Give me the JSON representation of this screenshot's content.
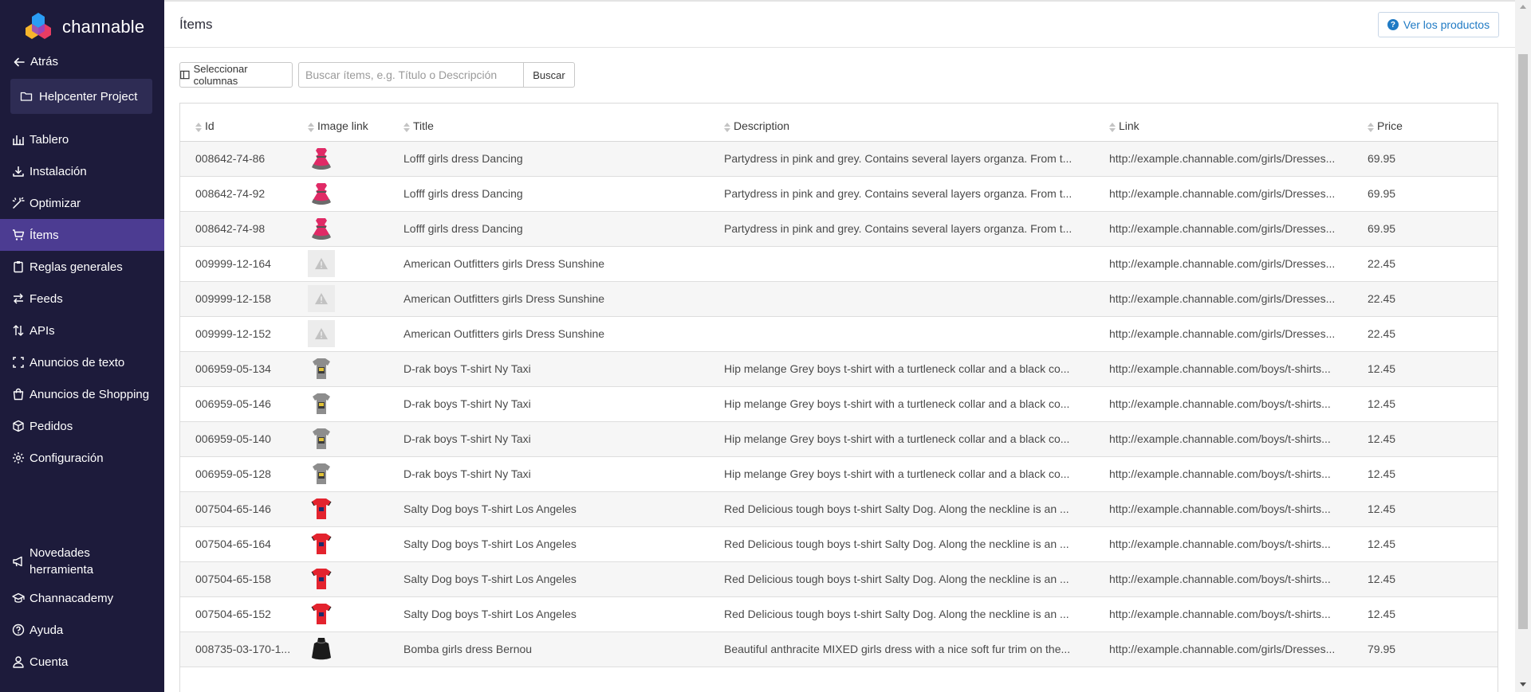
{
  "sidebar": {
    "logo_text": "channable",
    "back_label": "Atrás",
    "project_label": "Helpcenter Project",
    "nav": [
      {
        "label": "Tablero",
        "icon": "bar-chart-icon"
      },
      {
        "label": "Instalación",
        "icon": "download-icon"
      },
      {
        "label": "Optimizar",
        "icon": "magic-wand-icon"
      },
      {
        "label": "Ítems",
        "icon": "cart-icon",
        "active": true
      },
      {
        "label": "Reglas generales",
        "icon": "clipboard-icon"
      },
      {
        "label": "Feeds",
        "icon": "transfer-icon"
      },
      {
        "label": "APIs",
        "icon": "sort-arrows-icon"
      },
      {
        "label": "Anuncios de texto",
        "icon": "frame-icon"
      },
      {
        "label": "Anuncios de Shopping",
        "icon": "shopping-bag-icon"
      },
      {
        "label": "Pedidos",
        "icon": "box-icon"
      },
      {
        "label": "Configuración",
        "icon": "gear-icon"
      }
    ],
    "bottom": [
      {
        "label": "Novedades herramienta",
        "icon": "megaphone-icon"
      },
      {
        "label": "Channacademy",
        "icon": "graduation-cap-icon"
      },
      {
        "label": "Ayuda",
        "icon": "help-circle-icon"
      },
      {
        "label": "Cuenta",
        "icon": "user-icon"
      }
    ]
  },
  "header": {
    "title": "Ítems",
    "view_products_label": "Ver los productos"
  },
  "toolbar": {
    "select_columns_label": "Seleccionar columnas",
    "search_placeholder": "Buscar ítems, e.g. Título o Descripción",
    "search_button_label": "Buscar"
  },
  "table": {
    "columns": [
      "Id",
      "Image link",
      "Title",
      "Description",
      "Link",
      "Price"
    ],
    "rows": [
      {
        "id": "008642-74-86",
        "image": "pink-dress",
        "title": "Lofff girls dress Dancing",
        "description": "Partydress in pink and grey. Contains several layers organza. From t...",
        "link": "http://example.channable.com/girls/Dresses...",
        "price": "69.95"
      },
      {
        "id": "008642-74-92",
        "image": "pink-dress",
        "title": "Lofff girls dress Dancing",
        "description": "Partydress in pink and grey. Contains several layers organza. From t...",
        "link": "http://example.channable.com/girls/Dresses...",
        "price": "69.95"
      },
      {
        "id": "008642-74-98",
        "image": "pink-dress",
        "title": "Lofff girls dress Dancing",
        "description": "Partydress in pink and grey. Contains several layers organza. From t...",
        "link": "http://example.channable.com/girls/Dresses...",
        "price": "69.95"
      },
      {
        "id": "009999-12-164",
        "image": "missing",
        "title": "American Outfitters girls Dress Sunshine",
        "description": "",
        "link": "http://example.channable.com/girls/Dresses...",
        "price": "22.45"
      },
      {
        "id": "009999-12-158",
        "image": "missing",
        "title": "American Outfitters girls Dress Sunshine",
        "description": "",
        "link": "http://example.channable.com/girls/Dresses...",
        "price": "22.45"
      },
      {
        "id": "009999-12-152",
        "image": "missing",
        "title": "American Outfitters girls Dress Sunshine",
        "description": "",
        "link": "http://example.channable.com/girls/Dresses...",
        "price": "22.45"
      },
      {
        "id": "006959-05-134",
        "image": "grey-tshirt",
        "title": "D-rak boys T-shirt Ny Taxi",
        "description": "Hip melange Grey boys t-shirt with a turtleneck collar and a black co...",
        "link": "http://example.channable.com/boys/t-shirts...",
        "price": "12.45"
      },
      {
        "id": "006959-05-146",
        "image": "grey-tshirt",
        "title": "D-rak boys T-shirt Ny Taxi",
        "description": "Hip melange Grey boys t-shirt with a turtleneck collar and a black co...",
        "link": "http://example.channable.com/boys/t-shirts...",
        "price": "12.45"
      },
      {
        "id": "006959-05-140",
        "image": "grey-tshirt",
        "title": "D-rak boys T-shirt Ny Taxi",
        "description": "Hip melange Grey boys t-shirt with a turtleneck collar and a black co...",
        "link": "http://example.channable.com/boys/t-shirts...",
        "price": "12.45"
      },
      {
        "id": "006959-05-128",
        "image": "grey-tshirt",
        "title": "D-rak boys T-shirt Ny Taxi",
        "description": "Hip melange Grey boys t-shirt with a turtleneck collar and a black co...",
        "link": "http://example.channable.com/boys/t-shirts...",
        "price": "12.45"
      },
      {
        "id": "007504-65-146",
        "image": "red-tshirt",
        "title": "Salty Dog boys T-shirt Los Angeles",
        "description": "Red Delicious tough boys t-shirt Salty Dog. Along the neckline is an ...",
        "link": "http://example.channable.com/boys/t-shirts...",
        "price": "12.45"
      },
      {
        "id": "007504-65-164",
        "image": "red-tshirt",
        "title": "Salty Dog boys T-shirt Los Angeles",
        "description": "Red Delicious tough boys t-shirt Salty Dog. Along the neckline is an ...",
        "link": "http://example.channable.com/boys/t-shirts...",
        "price": "12.45"
      },
      {
        "id": "007504-65-158",
        "image": "red-tshirt",
        "title": "Salty Dog boys T-shirt Los Angeles",
        "description": "Red Delicious tough boys t-shirt Salty Dog. Along the neckline is an ...",
        "link": "http://example.channable.com/boys/t-shirts...",
        "price": "12.45"
      },
      {
        "id": "007504-65-152",
        "image": "red-tshirt",
        "title": "Salty Dog boys T-shirt Los Angeles",
        "description": "Red Delicious tough boys t-shirt Salty Dog. Along the neckline is an ...",
        "link": "http://example.channable.com/boys/t-shirts...",
        "price": "12.45"
      },
      {
        "id": "008735-03-170-1...",
        "image": "black-dress",
        "title": "Bomba girls dress Bernou",
        "description": "Beautiful anthracite MIXED girls dress with a nice soft fur trim on the...",
        "link": "http://example.channable.com/girls/Dresses...",
        "price": "79.95"
      }
    ]
  },
  "colors": {
    "sidebar_bg": "#1d1b3b",
    "active_nav": "#4c3c92",
    "link_blue": "#1f7ac4"
  }
}
